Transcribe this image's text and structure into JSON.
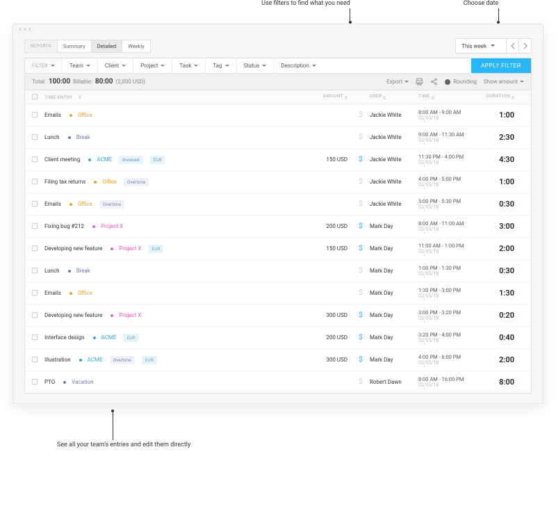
{
  "annotations": {
    "filters": "Use filters to find what you need",
    "date": "Choose date",
    "bottom": "See all your team's entries and edit them directly"
  },
  "tabs": {
    "prefix": "REPORTS",
    "items": [
      "Summary",
      "Detailed",
      "Weekly"
    ],
    "active": "Detailed"
  },
  "date_picker": {
    "label": "This week"
  },
  "filters": {
    "prefix": "FILTER",
    "items": [
      "Team",
      "Client",
      "Project",
      "Task",
      "Tag",
      "Status",
      "Description"
    ],
    "apply": "APPLY FILTER"
  },
  "summary": {
    "total_label": "Total:",
    "total": "100:00",
    "billable_label": "Billable:",
    "billable": "80:00",
    "billable_amount": "(2,000 USD)",
    "export": "Export",
    "rounding": "Rounding",
    "show_amount": "Show amount"
  },
  "columns": {
    "entry": "TIME ENTRY",
    "amount": "AMOUNT",
    "user": "USER",
    "time": "TIME",
    "duration": "DURATION"
  },
  "projects": {
    "office": {
      "name": "Office",
      "color": "#f0a020"
    },
    "break": {
      "name": "Break",
      "color": "#6a7ea8"
    },
    "acme": {
      "name": "ACME",
      "color": "#2aa8e0"
    },
    "projectx": {
      "name": "Project X",
      "color": "#e85fb0"
    },
    "vacation": {
      "name": "Vacation",
      "color": "#6a7ea8"
    }
  },
  "badges": {
    "invoiced": "Invoiced",
    "eur": "EUR",
    "overtime": "Overtime"
  },
  "rows": [
    {
      "title": "Emails",
      "project": "office",
      "badges": [],
      "amount": "",
      "billable": false,
      "user": "Jackie White",
      "time": "8:00 AM - 9:00 AM",
      "date": "03/05/18",
      "duration": "1:00"
    },
    {
      "title": "Lunch",
      "project": "break",
      "badges": [],
      "amount": "",
      "billable": false,
      "user": "Jackie White",
      "time": "9:00 AM - 11:30 AM",
      "date": "03/05/18",
      "duration": "2:30"
    },
    {
      "title": "Client meeting",
      "project": "acme",
      "badges": [
        "invoiced",
        "eur"
      ],
      "amount": "150 USD",
      "billable": true,
      "user": "Jackie White",
      "time": "11:30 PM - 4:00 PM",
      "date": "03/05/18",
      "duration": "4:30"
    },
    {
      "title": "Filing tax returns",
      "project": "office",
      "badges": [
        "overtime"
      ],
      "amount": "",
      "billable": false,
      "user": "Jackie White",
      "time": "4:00 PM - 5:00 PM",
      "date": "03/05/18",
      "duration": "1:00"
    },
    {
      "title": "Emails",
      "project": "office",
      "badges": [
        "overtime"
      ],
      "amount": "",
      "billable": false,
      "user": "Jackie White",
      "time": "5:00 PM - 5:30 PM",
      "date": "03/05/18",
      "duration": "0:30"
    },
    {
      "title": "Fixing bug #212",
      "project": "projectx",
      "badges": [],
      "amount": "200 USD",
      "billable": true,
      "user": "Mark Day",
      "time": "8:00 AM - 11:00 AM",
      "date": "03/05/18",
      "duration": "3:00"
    },
    {
      "title": "Developing new feature",
      "project": "projectx",
      "badges": [
        "eur"
      ],
      "amount": "150 USD",
      "billable": true,
      "user": "Mark Day",
      "time": "11:00 AM - 1:00 PM",
      "date": "03/05/18",
      "duration": "2:00"
    },
    {
      "title": "Lunch",
      "project": "break",
      "badges": [],
      "amount": "",
      "billable": false,
      "user": "Mark Day",
      "time": "1:00 PM - 1:30 PM",
      "date": "03/05/18",
      "duration": "0:30"
    },
    {
      "title": "Emails",
      "project": "office",
      "badges": [],
      "amount": "",
      "billable": false,
      "user": "Mark Day",
      "time": "1:30 PM - 3:00 PM",
      "date": "03/05/18",
      "duration": "1:30"
    },
    {
      "title": "Developing new feature",
      "project": "projectx",
      "badges": [],
      "amount": "300 USD",
      "billable": true,
      "user": "Mark Day",
      "time": "3:00 PM - 3:20 PM",
      "date": "03/05/18",
      "duration": "0:20"
    },
    {
      "title": "Interface design",
      "project": "acme",
      "badges": [
        "eur"
      ],
      "amount": "200 USD",
      "billable": true,
      "user": "Mark Day",
      "time": "3:20 PM - 4:00 PM",
      "date": "03/05/18",
      "duration": "0:40"
    },
    {
      "title": "Illustration",
      "project": "acme",
      "badges": [
        "overtime",
        "eur"
      ],
      "amount": "300 USD",
      "billable": true,
      "user": "Mark Day",
      "time": "4:00 PM - 6:00 PM",
      "date": "03/05/18",
      "duration": "2:00"
    },
    {
      "title": "PTO",
      "project": "vacation",
      "badges": [],
      "amount": "",
      "billable": false,
      "user": "Robert Dawn",
      "time": "8:00 AM - 16:00 PM",
      "date": "03/05/18",
      "duration": "8:00"
    }
  ]
}
